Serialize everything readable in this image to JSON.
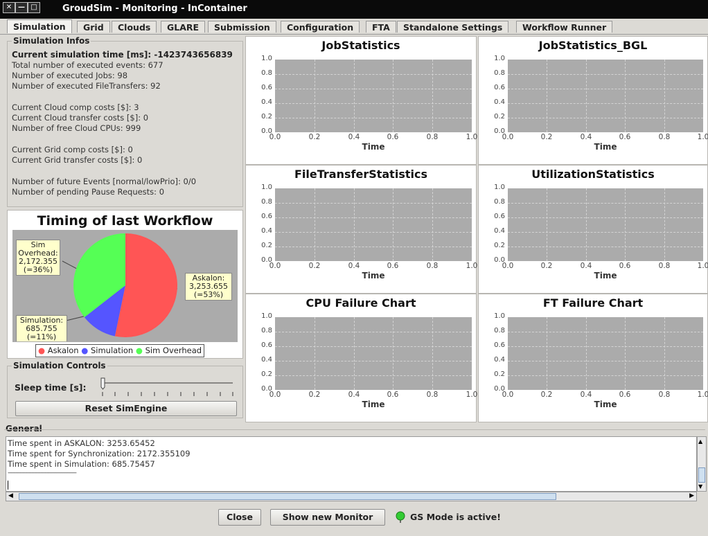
{
  "window": {
    "title": "GroudSim - Monitoring - InContainer",
    "buttons": [
      "✕",
      "—",
      "□"
    ]
  },
  "tabs": [
    {
      "label": "Simulation",
      "active": true
    },
    {
      "label": "Grid"
    },
    {
      "label": "Clouds"
    },
    {
      "label": "GLARE"
    },
    {
      "label": "Submission"
    },
    {
      "label": "Configuration"
    },
    {
      "label": "FTA"
    },
    {
      "label": "Standalone Settings"
    },
    {
      "label": "Workflow Runner"
    }
  ],
  "sim_infos": {
    "title": "Simulation Infos",
    "current_time": "Current simulation time [ms]: -1423743656839",
    "lines": [
      "Total number of executed events: 677",
      "Number of executed Jobs: 98",
      "Number of executed FileTransfers: 92",
      "Current Cloud comp costs [$]: 3",
      "Current Cloud transfer costs [$]: 0",
      "Number of free Cloud CPUs: 999",
      "Current Grid comp costs [$]: 0",
      "Current Grid transfer costs [$]: 0",
      "Number of future Events [normal/lowPrio]: 0/0",
      "Number of pending Pause Requests: 0"
    ]
  },
  "timing": {
    "title": "Timing of last Workflow",
    "callouts": {
      "askalon": [
        "Askalon:",
        "3,253.655",
        "(=53%)"
      ],
      "simulation": [
        "Simulation:",
        "685.755",
        "(=11%)"
      ],
      "overhead": [
        "Sim",
        "Overhead:",
        "2,172.355",
        "(=36%)"
      ]
    },
    "legend": [
      "Askalon",
      "Simulation",
      "Sim Overhead"
    ],
    "colors": {
      "askalon": "#ff5555",
      "simulation": "#5555ff",
      "overhead": "#55ff55"
    }
  },
  "chart_data": [
    {
      "type": "line",
      "title": "JobStatistics",
      "xlabel": "Time",
      "ylabel": "",
      "xlim": [
        0,
        1
      ],
      "ylim": [
        0,
        1
      ],
      "xticks": [
        "0.0",
        "0.2",
        "0.4",
        "0.6",
        "0.8",
        "1.0"
      ],
      "yticks": [
        "1.0",
        "0.8",
        "0.6",
        "0.4",
        "0.2",
        "0.0"
      ],
      "series": []
    },
    {
      "type": "line",
      "title": "JobStatistics_BGL",
      "xlabel": "Time",
      "ylabel": "",
      "xlim": [
        0,
        1
      ],
      "ylim": [
        0,
        1
      ],
      "xticks": [
        "0.0",
        "0.2",
        "0.4",
        "0.6",
        "0.8",
        "1.0"
      ],
      "yticks": [
        "1.0",
        "0.8",
        "0.6",
        "0.4",
        "0.2",
        "0.0"
      ],
      "series": []
    },
    {
      "type": "line",
      "title": "FileTransferStatistics",
      "xlabel": "Time",
      "ylabel": "",
      "xlim": [
        0,
        1
      ],
      "ylim": [
        0,
        1
      ],
      "xticks": [
        "0.0",
        "0.2",
        "0.4",
        "0.6",
        "0.8",
        "1.0"
      ],
      "yticks": [
        "1.0",
        "0.8",
        "0.6",
        "0.4",
        "0.2",
        "0.0"
      ],
      "series": []
    },
    {
      "type": "line",
      "title": "UtilizationStatistics",
      "xlabel": "Time",
      "ylabel": "",
      "xlim": [
        0,
        1
      ],
      "ylim": [
        0,
        1
      ],
      "xticks": [
        "0.0",
        "0.2",
        "0.4",
        "0.6",
        "0.8",
        "1.0"
      ],
      "yticks": [
        "1.0",
        "0.8",
        "0.6",
        "0.4",
        "0.2",
        "0.0"
      ],
      "series": []
    },
    {
      "type": "line",
      "title": "CPU Failure Chart",
      "xlabel": "Time",
      "ylabel": "",
      "xlim": [
        0,
        1
      ],
      "ylim": [
        0,
        1
      ],
      "xticks": [
        "0.0",
        "0.2",
        "0.4",
        "0.6",
        "0.8",
        "1.0"
      ],
      "yticks": [
        "1.0",
        "0.8",
        "0.6",
        "0.4",
        "0.2",
        "0.0"
      ],
      "series": []
    },
    {
      "type": "line",
      "title": "FT Failure Chart",
      "xlabel": "Time",
      "ylabel": "",
      "xlim": [
        0,
        1
      ],
      "ylim": [
        0,
        1
      ],
      "xticks": [
        "0.0",
        "0.2",
        "0.4",
        "0.6",
        "0.8",
        "1.0"
      ],
      "yticks": [
        "1.0",
        "0.8",
        "0.6",
        "0.4",
        "0.2",
        "0.0"
      ],
      "series": []
    },
    {
      "type": "pie",
      "title": "Timing of last Workflow",
      "categories": [
        "Askalon",
        "Simulation",
        "Sim Overhead"
      ],
      "values": [
        3253.655,
        685.755,
        2172.355
      ],
      "percents": [
        53,
        11,
        36
      ]
    }
  ],
  "controls": {
    "title": "Simulation Controls",
    "sleep_label": "Sleep time [s]:",
    "sleep_value": 0,
    "reset_label": "Reset SimEngine"
  },
  "general": {
    "title": "General",
    "log": [
      "Time spent in ASKALON: 3253.65452",
      "Time spent for Synchronization: 2172.355109",
      "Time spent in Simulation: 685.75457",
      "--------------------------------------------"
    ]
  },
  "footer": {
    "close_label": "Close",
    "show_monitor_label": "Show new Monitor",
    "status_text": "GS Mode is active!"
  }
}
